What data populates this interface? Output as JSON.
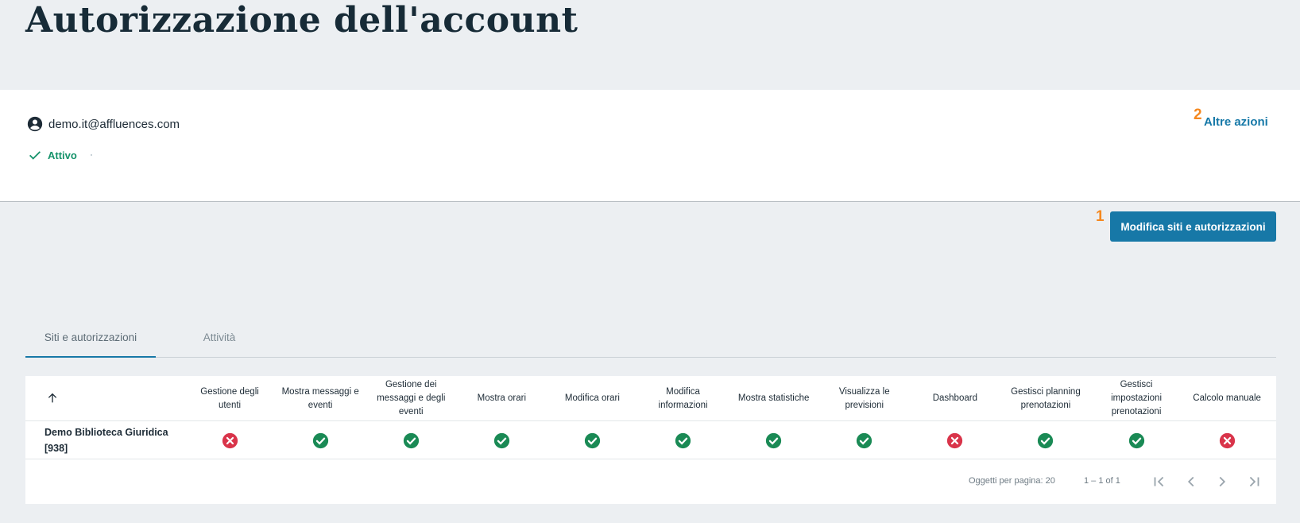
{
  "page": {
    "title": "Autorizzazione dell'account"
  },
  "account": {
    "icon": "account-circle-icon",
    "email": "demo.it@affluences.com",
    "status_icon": "check-icon",
    "status": "Attivo",
    "more_actions_label": "Altre azioni"
  },
  "markers": {
    "one": "1",
    "two": "2"
  },
  "actions": {
    "edit_label": "Modifica siti e autorizzazioni"
  },
  "tabs": [
    {
      "label": "Siti e autorizzazioni",
      "active": true
    },
    {
      "label": "Attività",
      "active": false
    }
  ],
  "table": {
    "sort_icon": "arrow-up-icon",
    "columns": [
      "Gestione degli utenti",
      "Mostra messaggi e eventi",
      "Gestione dei messaggi e degli eventi",
      "Mostra orari",
      "Modifica orari",
      "Modifica informazioni",
      "Mostra statistiche",
      "Visualizza le previsioni",
      "Dashboard",
      "Gestisci planning prenotazioni",
      "Gestisci impostazioni prenotazioni",
      "Calcolo manuale"
    ],
    "rows": [
      {
        "site_name": "Demo Biblioteca Giuridica",
        "site_id": "[938]",
        "permissions": [
          false,
          true,
          true,
          true,
          true,
          true,
          true,
          true,
          false,
          true,
          true,
          false
        ]
      }
    ]
  },
  "pagination": {
    "items_per_page": "Oggetti per pagina: 20",
    "range": "1 – 1 of 1",
    "icons": [
      "first-page-icon",
      "previous-page-icon",
      "next-page-icon",
      "last-page-icon"
    ]
  },
  "colors": {
    "accent": "#1778a7",
    "granted": "#1a8a55",
    "denied": "#d9344a",
    "status_active": "#16936b",
    "marker": "#f5881f"
  }
}
